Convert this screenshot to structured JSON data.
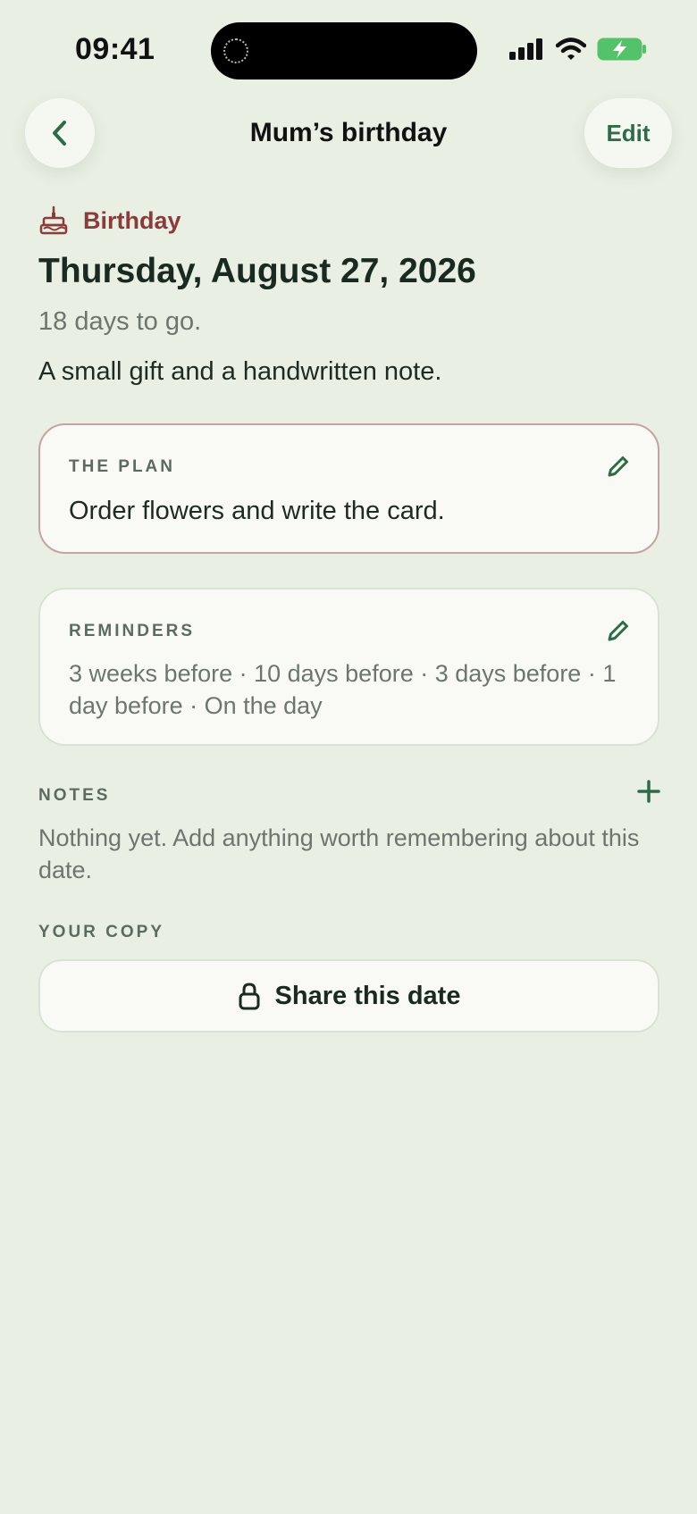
{
  "status_bar": {
    "time": "09:41"
  },
  "nav": {
    "title": "Mum’s birthday",
    "edit_label": "Edit"
  },
  "event": {
    "category": "Birthday",
    "date": "Thursday, August 27, 2026",
    "countdown": "18 days to go.",
    "description": "A small gift and a handwritten note."
  },
  "plan": {
    "label": "THE PLAN",
    "text": "Order flowers and write the card."
  },
  "reminders": {
    "label": "REMINDERS",
    "text": "3 weeks before · 10 days before · 3 days before · 1 day before · On the day"
  },
  "notes": {
    "label": "NOTES",
    "empty_text": "Nothing yet. Add anything worth remembering about this date."
  },
  "copy": {
    "label": "YOUR COPY",
    "share_label": "Share this date"
  },
  "colors": {
    "accent": "#2f6b48",
    "category": "#8a3b3b",
    "background": "#e9efe3",
    "card": "#f9faf6"
  },
  "icons": [
    "chevron-left-icon",
    "cake-icon",
    "pencil-icon",
    "plus-icon",
    "lock-icon",
    "signal-icon",
    "wifi-icon",
    "battery-icon"
  ]
}
